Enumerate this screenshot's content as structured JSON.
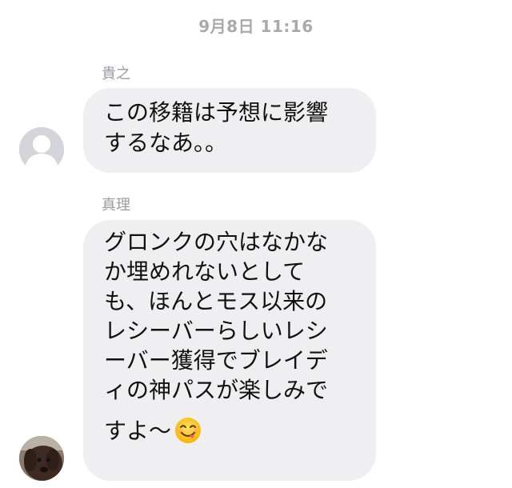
{
  "timestamp": "9月8日 11:16",
  "messages": [
    {
      "sender": "貴之",
      "text": "この移籍は予想に影響\nするなあ。。",
      "avatar": "default-avatar-icon"
    },
    {
      "sender": "真理",
      "text": "グロンクの穴はなかな\nか埋めれないとして\nも、ほんとモス以来の\nレシーバーらしいレシ\nーバー獲得でブレイデ\nィの神パスが楽しみで",
      "text_last": "すよ〜",
      "emoji": "yum-face-emoji",
      "avatar": "dog-photo-avatar"
    }
  ],
  "colors": {
    "bubble": "#efeff1",
    "timestamp": "#a9a9ae",
    "sender": "#9a9aa0",
    "avatar_default": "#d3d5db"
  }
}
